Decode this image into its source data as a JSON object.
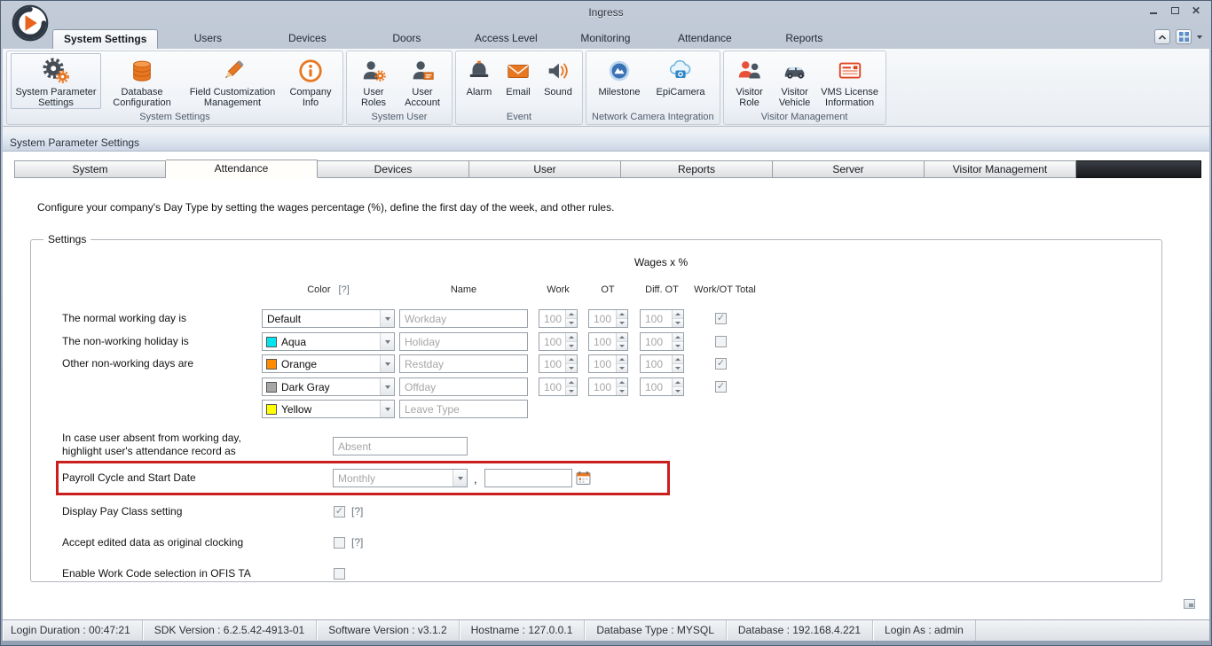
{
  "window": {
    "title": "Ingress"
  },
  "ribbon": {
    "tabs": [
      {
        "label": "System Settings",
        "active": true
      },
      {
        "label": "Users"
      },
      {
        "label": "Devices"
      },
      {
        "label": "Doors"
      },
      {
        "label": "Access Level"
      },
      {
        "label": "Monitoring"
      },
      {
        "label": "Attendance"
      },
      {
        "label": "Reports"
      }
    ],
    "groups": [
      {
        "label": "System Settings",
        "items": [
          {
            "label": "System Parameter Settings",
            "icon": "gears-icon",
            "selected": true
          },
          {
            "label": "Database Configuration",
            "icon": "database-icon"
          },
          {
            "label": "Field Customization Management",
            "icon": "pencil-icon"
          },
          {
            "label": "Company Info",
            "icon": "info-icon"
          }
        ]
      },
      {
        "label": "System User",
        "items": [
          {
            "label": "User Roles",
            "icon": "user-gear-icon"
          },
          {
            "label": "User Account",
            "icon": "user-card-icon"
          }
        ]
      },
      {
        "label": "Event",
        "items": [
          {
            "label": "Alarm",
            "icon": "alarm-icon"
          },
          {
            "label": "Email",
            "icon": "email-icon"
          },
          {
            "label": "Sound",
            "icon": "speaker-icon"
          }
        ]
      },
      {
        "label": "Network Camera Integration",
        "items": [
          {
            "label": "Milestone",
            "icon": "milestone-icon"
          },
          {
            "label": "EpiCamera",
            "icon": "epicamera-cloud-icon"
          }
        ]
      },
      {
        "label": "Visitor Management",
        "items": [
          {
            "label": "Visitor Role",
            "icon": "visitor-role-icon"
          },
          {
            "label": "Visitor Vehicle",
            "icon": "car-icon"
          },
          {
            "label": "VMS License Information",
            "icon": "license-card-icon"
          }
        ]
      }
    ]
  },
  "panel": {
    "header": "System Parameter Settings",
    "tabs": [
      {
        "label": "System"
      },
      {
        "label": "Attendance",
        "active": true
      },
      {
        "label": "Devices"
      },
      {
        "label": "User"
      },
      {
        "label": "Reports"
      },
      {
        "label": "Server"
      },
      {
        "label": "Visitor Management"
      }
    ],
    "description": "Configure your company's Day Type by setting the wages percentage (%), define the first day of the week, and other rules.",
    "settings": {
      "legend": "Settings",
      "wages_header": "Wages x %",
      "columns": {
        "color": "Color",
        "help": "[?]",
        "name": "Name",
        "work": "Work",
        "ot": "OT",
        "diff_ot": "Diff. OT",
        "total": "Work/OT Total"
      },
      "day_rows": [
        {
          "label": "The normal working day is",
          "color_name": "Default",
          "swatch": "",
          "name": "Workday",
          "work": "100",
          "ot": "100",
          "diff_ot": "100",
          "total_checked": true
        },
        {
          "label": "The non-working holiday is",
          "color_name": "Aqua",
          "swatch": "#00e5ee",
          "name": "Holiday",
          "work": "100",
          "ot": "100",
          "diff_ot": "100",
          "total_checked": false
        },
        {
          "label": "Other non-working days are",
          "color_name": "Orange",
          "swatch": "#ff8c00",
          "name": "Restday",
          "work": "100",
          "ot": "100",
          "diff_ot": "100",
          "total_checked": true
        },
        {
          "label": "",
          "color_name": "Dark Gray",
          "swatch": "#a6a6a6",
          "name": "Offday",
          "work": "100",
          "ot": "100",
          "diff_ot": "100",
          "total_checked": true
        },
        {
          "label": "",
          "color_name": "Yellow",
          "swatch": "#ffff00",
          "name": "Leave Type"
        }
      ],
      "absent_row": {
        "label_line1": "In case user absent from working day,",
        "label_line2": "highlight user's attendance record as",
        "value": "Absent"
      },
      "payroll_row": {
        "label": "Payroll Cycle and Start Date",
        "cycle": "Monthly",
        "comma": ",",
        "date_value": "",
        "highlight_color": "#c9201d"
      },
      "option_rows": [
        {
          "label": "Display Pay Class setting",
          "checked": true,
          "help": "[?]"
        },
        {
          "label": "Accept edited data as original clocking",
          "checked": false,
          "help": "[?]"
        },
        {
          "label": "Enable Work Code selection in OFIS TA",
          "checked": false,
          "help": ""
        }
      ]
    }
  },
  "status_bar": {
    "items": [
      "Login Duration : 00:47:21",
      "SDK Version : 6.2.5.42-4913-01",
      "Software Version : v3.1.2",
      "Hostname : 127.0.0.1",
      "Database Type : MYSQL",
      "Database : 192.168.4.221",
      "Login As : admin"
    ]
  },
  "colors": {
    "accent_orange": "#e87722",
    "highlight_red": "#c9201d"
  }
}
